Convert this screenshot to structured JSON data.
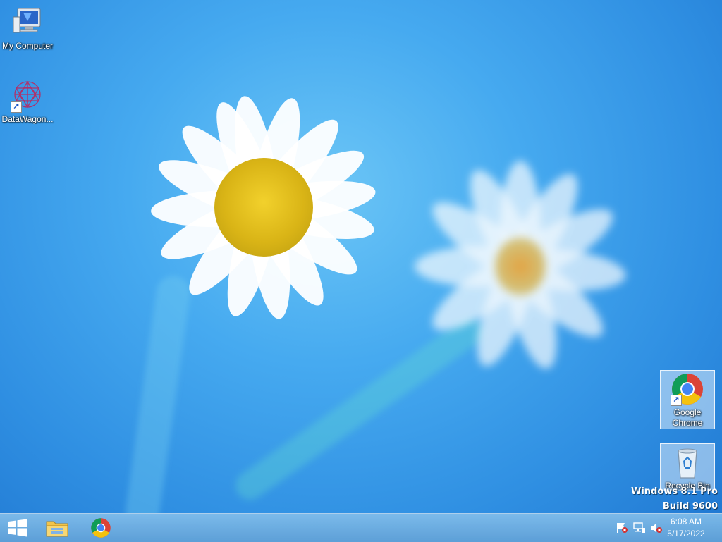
{
  "desktop": {
    "icons_left": [
      {
        "label": "My Computer",
        "icon": "computer-icon"
      },
      {
        "label": "DataWagon...",
        "icon": "datawagon-icon"
      }
    ],
    "icons_right": [
      {
        "label": "Google Chrome",
        "icon": "chrome-icon"
      },
      {
        "label": "Recycle Bin",
        "icon": "recycle-bin-icon"
      }
    ],
    "watermark": {
      "line1": "Windows 8.1 Pro",
      "line2": "Build 9600"
    }
  },
  "taskbar": {
    "pinned": [
      {
        "name": "start",
        "icon": "windows-logo-icon"
      },
      {
        "name": "file-explorer",
        "icon": "folder-icon"
      },
      {
        "name": "chrome",
        "icon": "chrome-icon"
      }
    ],
    "tray": [
      {
        "name": "action-center",
        "icon": "flag-warning-icon"
      },
      {
        "name": "network",
        "icon": "network-icon"
      },
      {
        "name": "volume",
        "icon": "volume-muted-icon"
      }
    ],
    "clock": {
      "time": "6:08 AM",
      "date": "5/17/2022"
    }
  },
  "colors": {
    "accent": "#3b9be8",
    "taskbar": "#6fb0e0"
  }
}
